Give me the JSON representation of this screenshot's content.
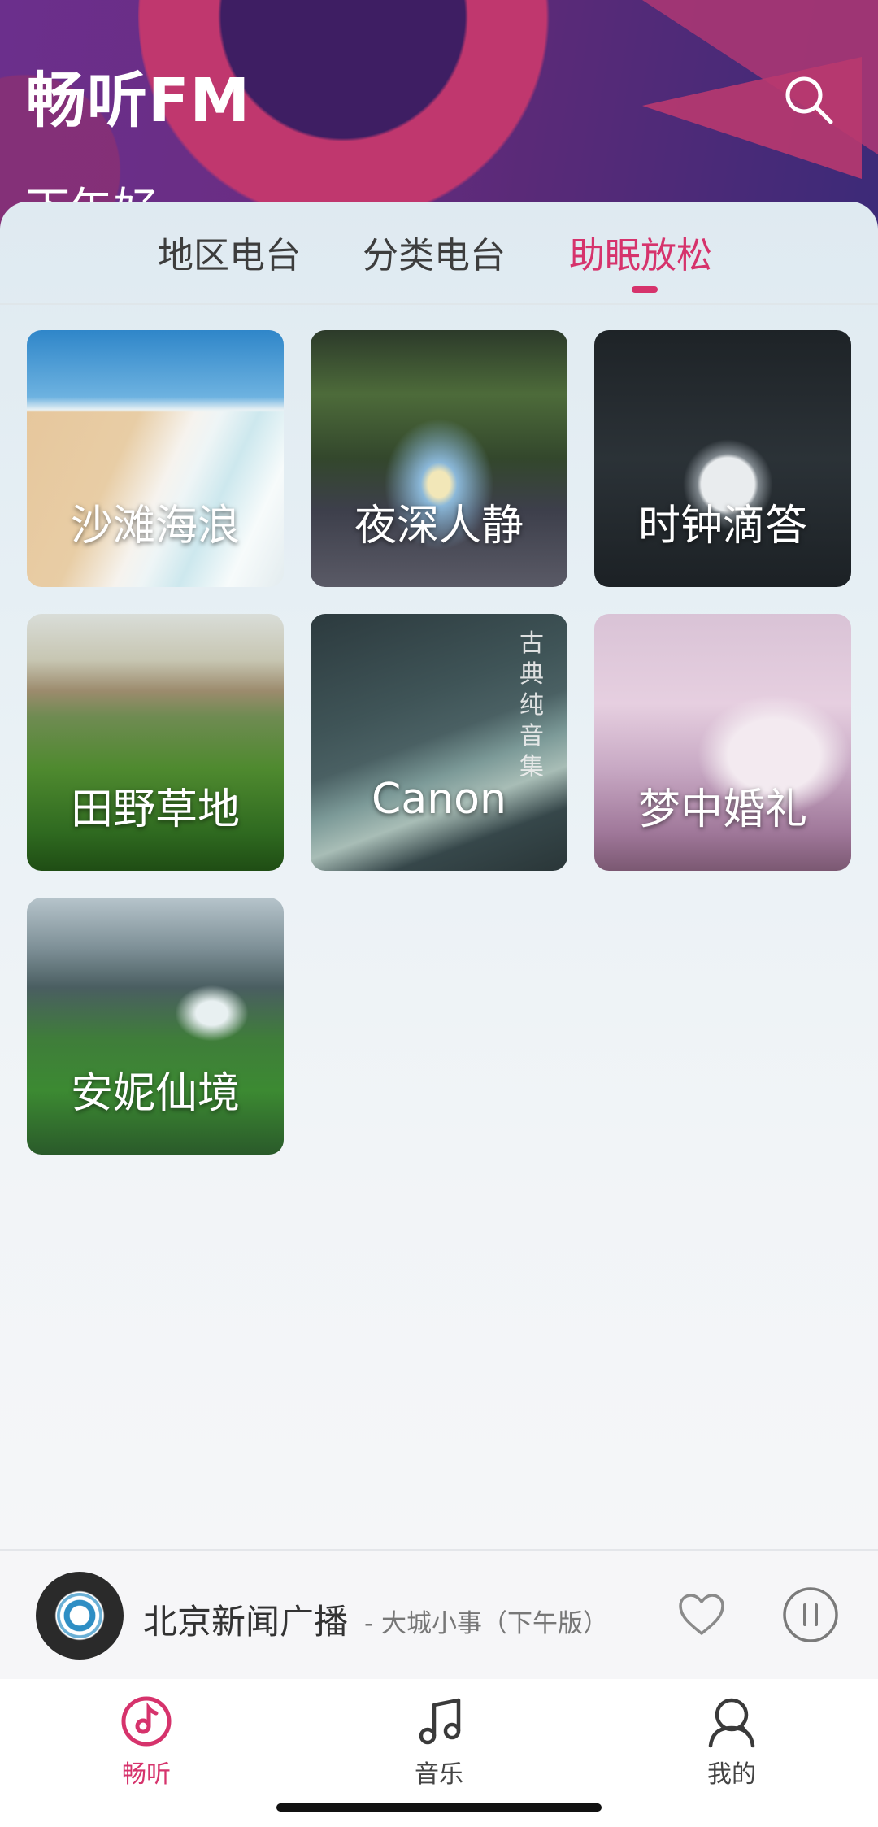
{
  "header": {
    "title": "畅听FM",
    "greeting": "下午好",
    "search_icon": "search-icon"
  },
  "tabs": [
    {
      "label": "地区电台",
      "active": false
    },
    {
      "label": "分类电台",
      "active": false
    },
    {
      "label": "助眠放松",
      "active": true
    }
  ],
  "cards": [
    {
      "label": "沙滩海浪"
    },
    {
      "label": "夜深人静"
    },
    {
      "label": "时钟滴答"
    },
    {
      "label": "田野草地"
    },
    {
      "label": "Canon",
      "side_text": "古典纯音集"
    },
    {
      "label": "梦中婚礼"
    },
    {
      "label": "安妮仙境"
    }
  ],
  "player": {
    "station": "北京新闻广播",
    "program": "- 大城小事（下午版）",
    "icons": [
      "heart-icon",
      "pause-icon"
    ]
  },
  "nav": [
    {
      "label": "畅听",
      "icon": "radio-note-icon",
      "active": true
    },
    {
      "label": "音乐",
      "icon": "music-note-icon",
      "active": false
    },
    {
      "label": "我的",
      "icon": "user-icon",
      "active": false
    }
  ],
  "colors": {
    "accent": "#d6336c",
    "header_purple": "#6b2f8c"
  }
}
